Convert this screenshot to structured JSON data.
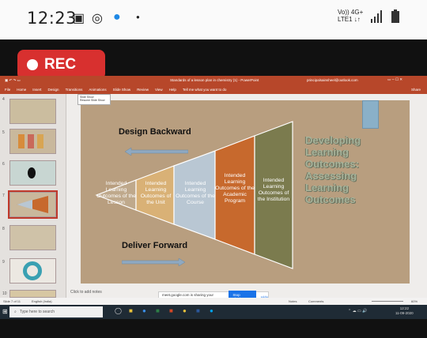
{
  "phone": {
    "time": "12:23",
    "network": "Vo)) 4G+\nLTE1 ↓↑"
  },
  "recording": {
    "label": "REC"
  },
  "window": {
    "title": "Standards of a lesson plan in chemistry (1) - PowerPoint",
    "user": "principalsainsheel@outlook.com",
    "tabs": [
      "File",
      "Home",
      "Insert",
      "Design",
      "Transitions",
      "Animations",
      "Slide Show",
      "Review",
      "View",
      "Help"
    ],
    "tell_me": "Tell me what you want to do",
    "share": "Share"
  },
  "slide_panel": {
    "numbers": [
      "4",
      "5",
      "6",
      "7",
      "8",
      "9",
      "10"
    ],
    "selected_index": 3
  },
  "dropdown": {
    "label": "Slide Show",
    "item": "Resume Slide Show"
  },
  "slide": {
    "design_title": "Design Backward",
    "deliver_title": "Deliver Forward",
    "side_title": "Developing Learning Outcomes: Assessing Learning Outcomes",
    "segments": [
      {
        "label": "Intended Learning Outcomes of the Lesson",
        "color": "#bfa98c"
      },
      {
        "label": "Intended Learning Outcomes of the Unit",
        "color": "#d9b176"
      },
      {
        "label": "Intended Learning Outcomes of the Course",
        "color": "#b9c7d3"
      },
      {
        "label": "Intended Learning Outcomes of the Academic Program",
        "color": "#c7692d"
      },
      {
        "label": "Intended Learning Outcomes of the Institution",
        "color": "#7b7b4e"
      }
    ]
  },
  "notes_placeholder": "Click to add notes",
  "status": {
    "slide": "Slide 7 of 11",
    "lang": "English (India)",
    "notes": "Notes",
    "comments": "Comments",
    "zoom": "60%"
  },
  "share_bar": {
    "text": "meet.google.com is sharing your screen.",
    "stop": "Stop sharing",
    "hide": "Hide"
  },
  "taskbar": {
    "search": "Type here to search",
    "time": "12:22",
    "date": "11-09-2020"
  }
}
